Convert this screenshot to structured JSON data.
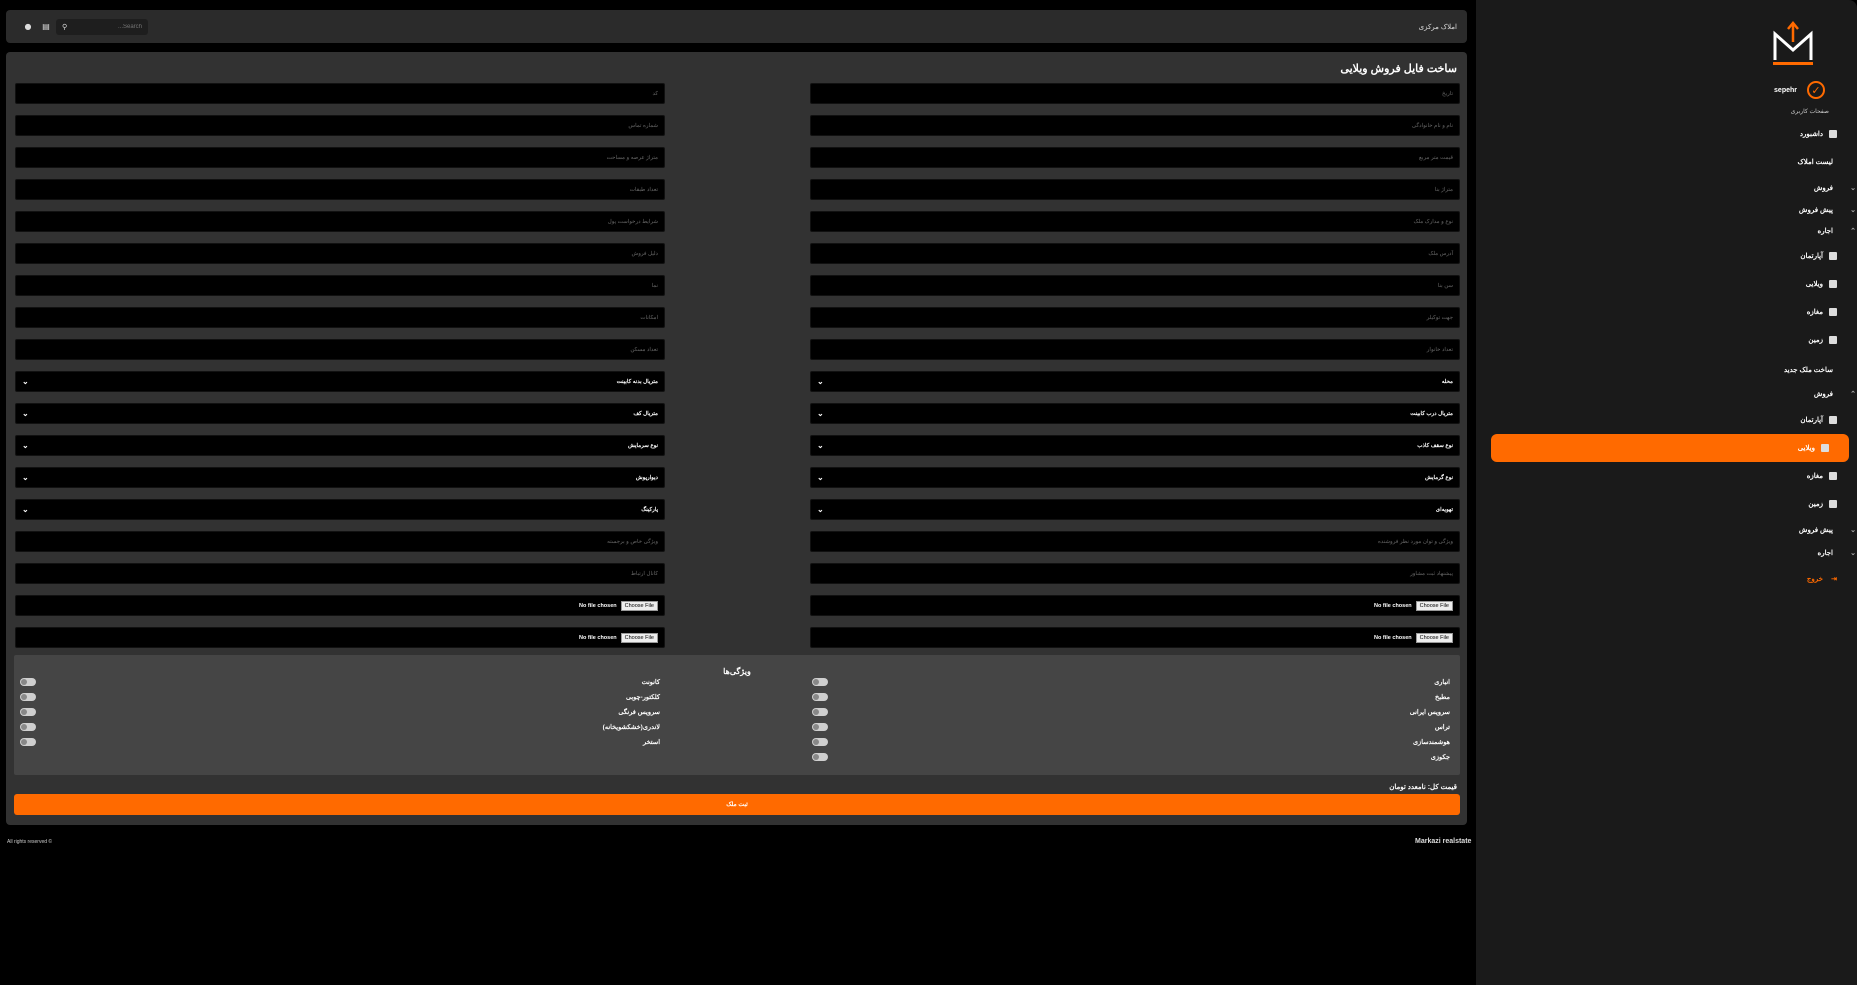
{
  "topbar": {
    "title": "املاک مرکزی",
    "search_placeholder": "...Search"
  },
  "sidebar": {
    "user_name": "sepehr",
    "user_pages_label": "صفحات کاربری",
    "items": [
      {
        "label": "داشبورد",
        "icon": "dashboard-icon"
      },
      {
        "label": "لیست املاک"
      },
      {
        "label": "فروش",
        "chevron": "down"
      },
      {
        "label": "پیش فروش",
        "chevron": "down"
      },
      {
        "label": "اجاره",
        "chevron": "up"
      },
      {
        "label": "آپارتمان",
        "icon": "building-icon"
      },
      {
        "label": "ویلایی",
        "icon": "building-icon"
      },
      {
        "label": "مغازه",
        "icon": "building-icon"
      },
      {
        "label": "زمین",
        "icon": "building-icon"
      },
      {
        "label": "ساخت ملک جدید"
      },
      {
        "label": "فروش",
        "chevron": "up"
      },
      {
        "label": "آپارتمان",
        "icon": "building-icon"
      },
      {
        "label": "ویلایی",
        "icon": "building-icon",
        "active": true
      },
      {
        "label": "مغازه",
        "icon": "building-icon"
      },
      {
        "label": "زمین",
        "icon": "building-icon"
      },
      {
        "label": "پیش فروش",
        "chevron": "down"
      },
      {
        "label": "اجاره",
        "chevron": "down"
      },
      {
        "label": "خروج",
        "icon": "exit-icon"
      }
    ]
  },
  "form": {
    "title": "ساخت فایل فروش ویلایی",
    "right_fields": [
      "تاریخ",
      "نام و نام خانوادگی",
      "قیمت متر مربع",
      "متراژ بنا",
      "نوع و مدارک ملک",
      "آدرس ملک",
      "سن بنا",
      "جهت توکیلر",
      "تعداد خانوار"
    ],
    "left_fields": [
      "کد",
      "شماره تماس",
      "متراژ عرصه و مساحت",
      "تعداد طبقات",
      "شرایط درخواست پول",
      "دلیل فروش",
      "نما",
      "امکانات",
      "تعداد مسکن"
    ],
    "right_selects": [
      "محله",
      "متریال درب کابینت",
      "نوع سقف کاذب",
      "نوع گرمایش",
      "تهویه‌ای"
    ],
    "left_selects": [
      "متریال بدنه کابینت",
      "متریال کف",
      "نوع سرمایش",
      "دیوارپوش",
      "پارکینگ"
    ],
    "right_text2": [
      "ویژگی و توان مورد نظر فروشنده",
      "پیشنهاد ثبت مشاور"
    ],
    "left_text2": [
      "ویژگی خاص و برجسته",
      "کانال ارتباط"
    ],
    "file_button": "Choose File",
    "file_status": "No file chosen",
    "features_title": "ویژگی‌ها",
    "features_right": [
      "انباری",
      "مطبخ",
      "سرویس ایرانی",
      "تراس",
      "هوشمندسازی",
      "جکوزی"
    ],
    "features_left": [
      "کانونت",
      "کلکتور-چوبی",
      "سرویس فرنگی",
      "لاندری(خشکشویخانه)",
      "استخر"
    ],
    "total_price": "قیمت کل: نامعدد تومان",
    "submit_label": "ثبت ملک"
  },
  "footer": {
    "brand": "Markazi realstate",
    "rights": "All rights reserved ©"
  },
  "colors": {
    "accent": "#ff6a00",
    "panel": "#323232",
    "sidebar": "#1a1a1a"
  }
}
